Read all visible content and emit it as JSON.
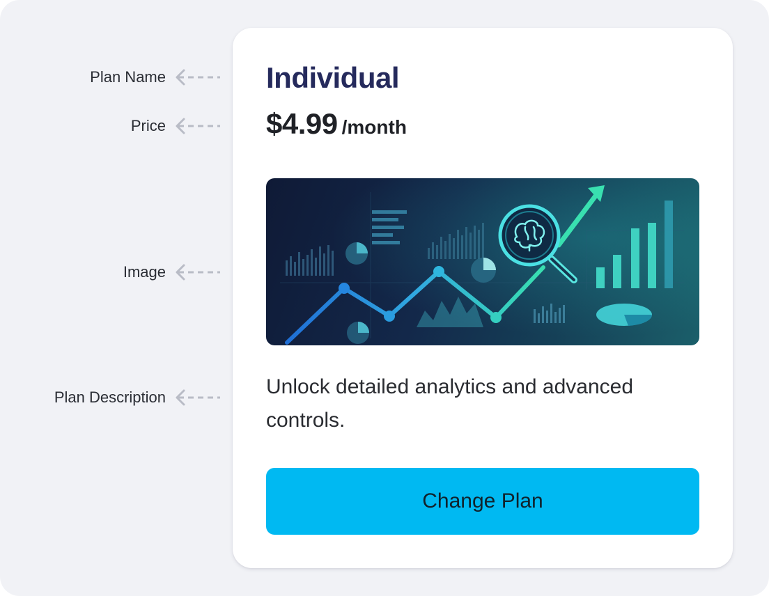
{
  "annotations": [
    {
      "label": "Plan Name"
    },
    {
      "label": "Price"
    },
    {
      "label": "Image"
    },
    {
      "label": "Plan Description"
    }
  ],
  "plan": {
    "name": "Individual",
    "price": "$4.99",
    "period": "/month",
    "description": "Unlock detailed analytics and advanced controls.",
    "button_label": "Change Plan"
  },
  "colors": {
    "page_bg": "#f1f2f6",
    "card_bg": "#ffffff",
    "plan_name": "#252a5c",
    "button_bg": "#00b9f2",
    "annotation_arrow": "#b9bcc6"
  },
  "image": {
    "icon": "analytics-illustration"
  }
}
